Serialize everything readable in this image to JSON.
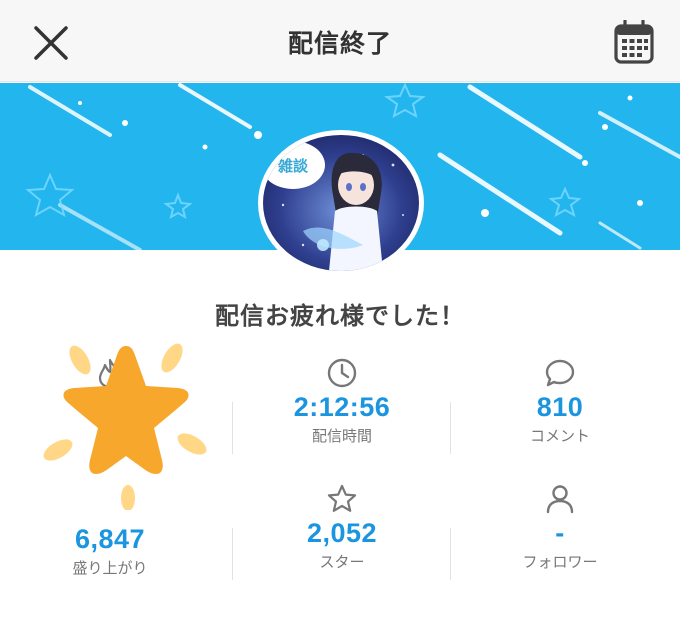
{
  "header": {
    "title": "配信終了",
    "close_icon": "close-icon",
    "calendar_icon": "calendar-icon"
  },
  "banner": {
    "background_color": "#22b5ee",
    "avatar_text": "雑談"
  },
  "message": "配信お疲れ様でした！",
  "stats": [
    {
      "icon": "flame-icon",
      "value": "6,847",
      "label": "盛り上がり"
    },
    {
      "icon": "clock-icon",
      "value": "2:12:56",
      "label": "配信時間"
    },
    {
      "icon": "speech-bubble-icon",
      "value": "810",
      "label": "コメント"
    },
    {
      "icon": "star-outline-icon",
      "value": "2,052",
      "label": "スター"
    },
    {
      "icon": "person-icon",
      "value": "-",
      "label": "フォロワー"
    }
  ],
  "colors": {
    "accent": "#1b95e0",
    "star": "#f7a72b",
    "header_bg": "#f7f7f7"
  }
}
